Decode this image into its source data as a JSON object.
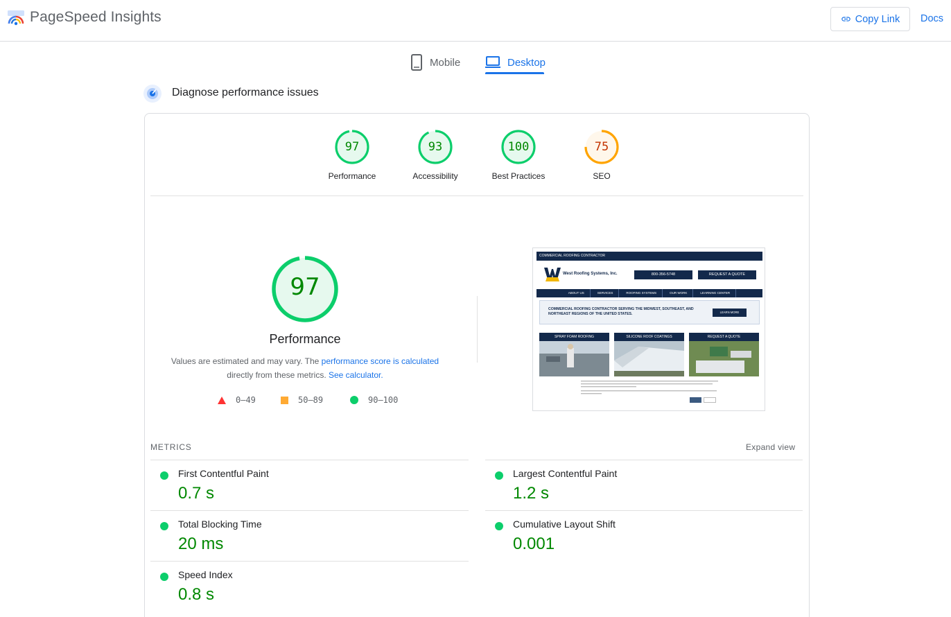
{
  "header": {
    "app_title": "PageSpeed Insights",
    "copy_link_label": "Copy Link",
    "docs_label": "Docs"
  },
  "tabs": [
    {
      "label": "Mobile",
      "icon": "smartphone-icon",
      "active": false
    },
    {
      "label": "Desktop",
      "icon": "laptop-icon",
      "active": true
    }
  ],
  "section_title": "Diagnose performance issues",
  "scores": [
    {
      "label": "Performance",
      "value": "97",
      "fraction": 0.97,
      "status": "good"
    },
    {
      "label": "Accessibility",
      "value": "93",
      "fraction": 0.93,
      "status": "good"
    },
    {
      "label": "Best Practices",
      "value": "100",
      "fraction": 1.0,
      "status": "good"
    },
    {
      "label": "SEO",
      "value": "75",
      "fraction": 0.75,
      "status": "average"
    }
  ],
  "main_score": {
    "value": "97",
    "fraction": 0.97,
    "label": "Performance"
  },
  "description": {
    "part1": "Values are estimated and may vary. The ",
    "link1": "performance score is calculated",
    "part2": "directly from these metrics. ",
    "link2": "See calculator."
  },
  "legend": [
    {
      "shape": "triangle",
      "range": "0–49",
      "color": "#ff3333"
    },
    {
      "shape": "square",
      "range": "50–89",
      "color": "#ffaa33"
    },
    {
      "shape": "circle",
      "range": "90–100",
      "color": "#0cce6b"
    }
  ],
  "screenshot": {
    "top_bar": "COMMERCIAL ROOFING CONTRACTOR",
    "company": "West Roofing Systems, Inc.",
    "phone": "800-356-5748",
    "quote_button": "REQUEST A QUOTE",
    "nav": [
      "ABOUT US",
      "SERVICES",
      "ROOFING SYSTEMS",
      "OUR WORK",
      "LEARNING CENTER"
    ],
    "hero_text": "COMMERCIAL ROOFING CONTRACTOR SERVING THE MIDWEST, SOUTHEAST, AND NORTHEAST REGIONS OF THE UNITED STATES.",
    "hero_button": "LEARN MORE",
    "cards": [
      "SPRAY FOAM ROOFING",
      "SILICONE ROOF COATINGS",
      "REQUEST A QUOTE"
    ]
  },
  "metrics": {
    "title": "METRICS",
    "expand_label": "Expand view",
    "items": [
      {
        "name": "First Contentful Paint",
        "value": "0.7 s"
      },
      {
        "name": "Largest Contentful Paint",
        "value": "1.2 s"
      },
      {
        "name": "Total Blocking Time",
        "value": "20 ms"
      },
      {
        "name": "Cumulative Layout Shift",
        "value": "0.001"
      },
      {
        "name": "Speed Index",
        "value": "0.8 s"
      }
    ]
  },
  "colors": {
    "accent": "#1a73e8",
    "good": "#0cce6b",
    "good_text": "#008800",
    "average": "#ffa400",
    "average_text": "#c33300",
    "poor": "#ff3333",
    "site_navy": "#13294b"
  }
}
